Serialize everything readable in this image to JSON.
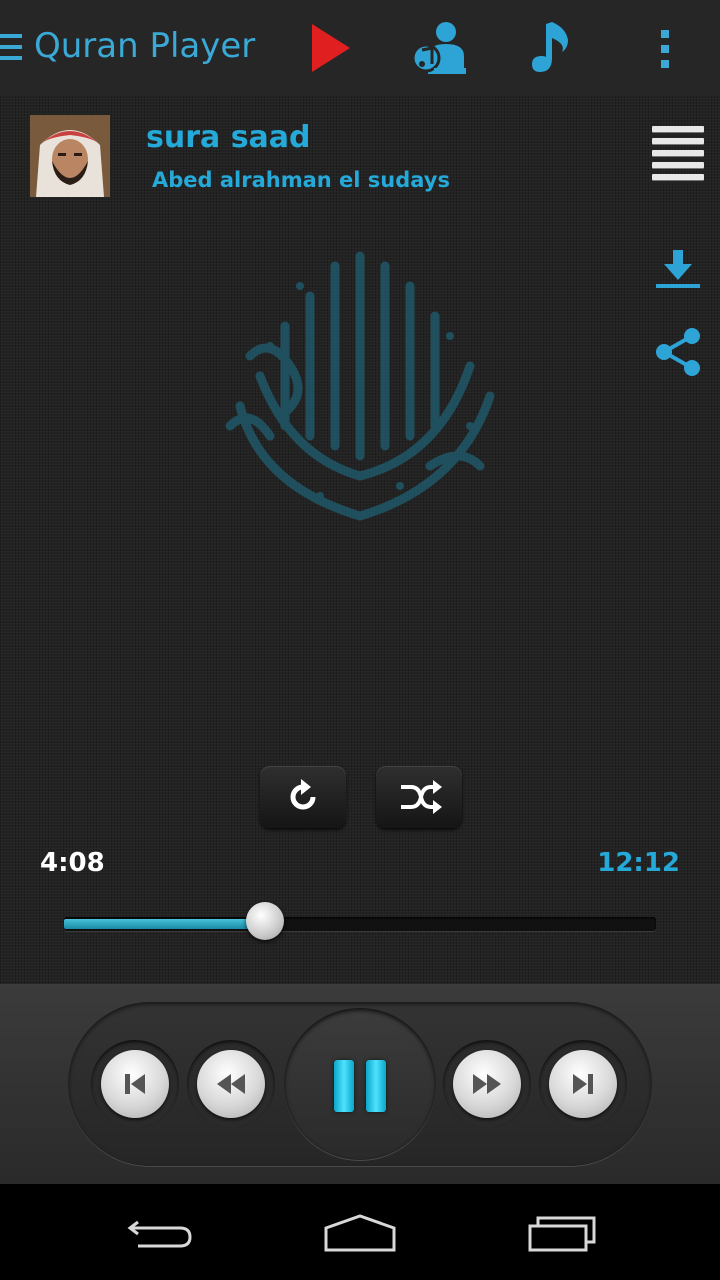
{
  "actionbar": {
    "title": "Quran Player",
    "icons": [
      "menu-icon",
      "play-icon",
      "reciter-icon",
      "music-note-icon",
      "overflow-icon"
    ]
  },
  "now_playing": {
    "title": "sura saad",
    "reciter": "Abed alrahman el sudays"
  },
  "playback": {
    "elapsed": "4:08",
    "duration": "12:12",
    "progress": 0.34
  },
  "colors": {
    "accent": "#25a9d8",
    "play_red": "#e02020",
    "pause_cyan": "#1fc6ee"
  }
}
